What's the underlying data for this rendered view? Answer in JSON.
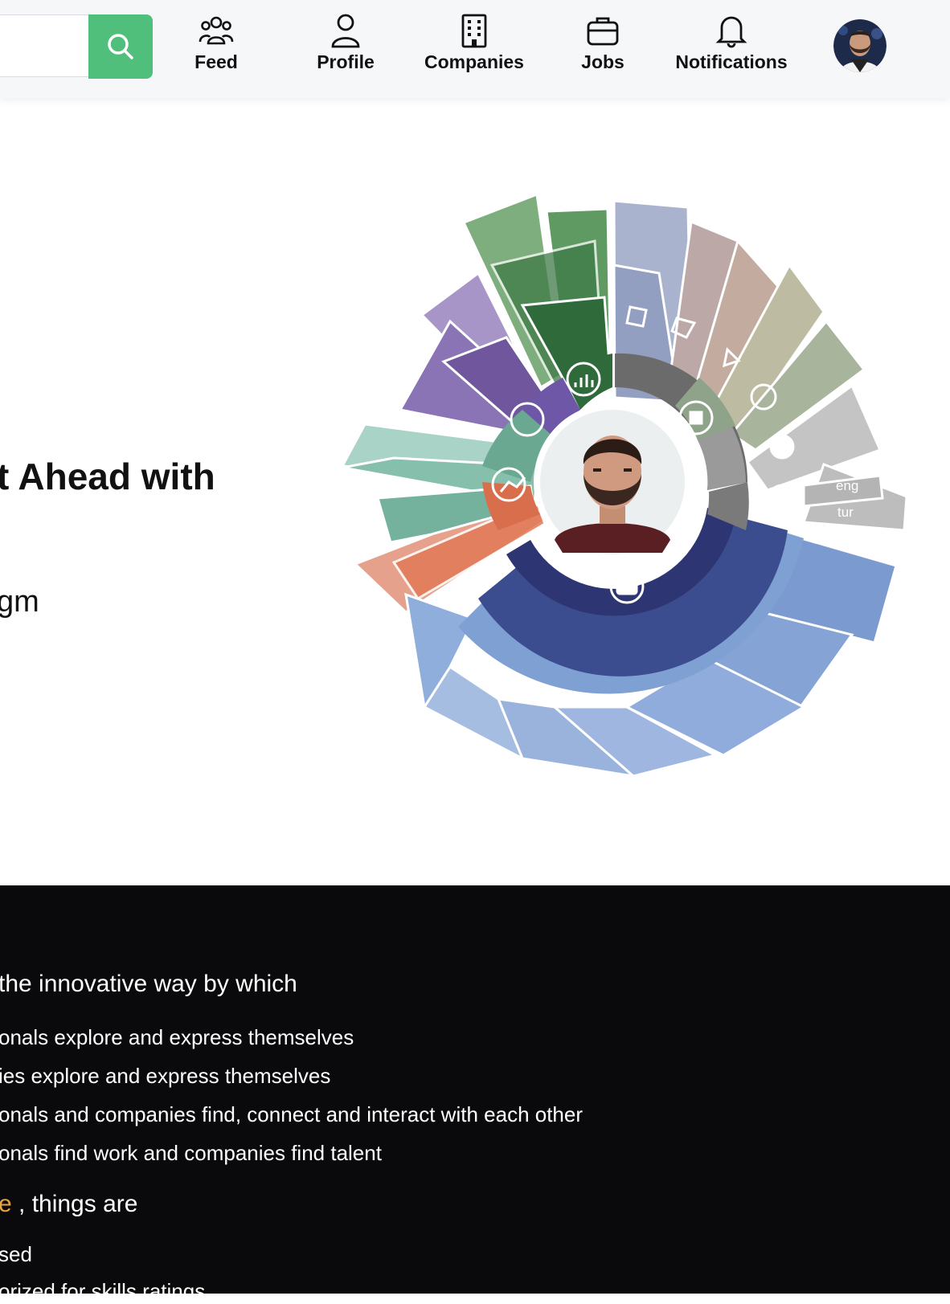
{
  "nav": {
    "search_placeholder": "",
    "search_icon": "search-icon",
    "accent_color": "#4fbf7b",
    "items": [
      {
        "label": "Feed",
        "icon": "people-icon"
      },
      {
        "label": "Profile",
        "icon": "user-icon"
      },
      {
        "label": "Companies",
        "icon": "building-icon"
      },
      {
        "label": "Jobs",
        "icon": "briefcase-icon"
      },
      {
        "label": "Notifications",
        "icon": "bell-icon"
      }
    ],
    "avatar_icon": "user-avatar"
  },
  "hero": {
    "title": "t Ahead with",
    "subtitle": "gm",
    "sunburst_labels": {
      "eng": "eng",
      "tur": "tur"
    },
    "segment_icons": [
      "bar-chart-icon",
      "square-node-icon",
      "polygon-node-icon",
      "triangle-node-icon",
      "cycle-icon",
      "gear-badge-icon",
      "globe-icon",
      "briefcase-icon",
      "path-icon",
      "palette-icon"
    ]
  },
  "about": {
    "lead1": " the innovative way by which",
    "items1": [
      "onals explore and express themselves",
      "ies explore and express themselves",
      "onals and companies find, connect and interact with each other",
      "onals find work and companies find talent"
    ],
    "lead2_accent": "e",
    "lead2_rest": " , things are",
    "items2": [
      "sed",
      "orized for skills ratings"
    ]
  }
}
